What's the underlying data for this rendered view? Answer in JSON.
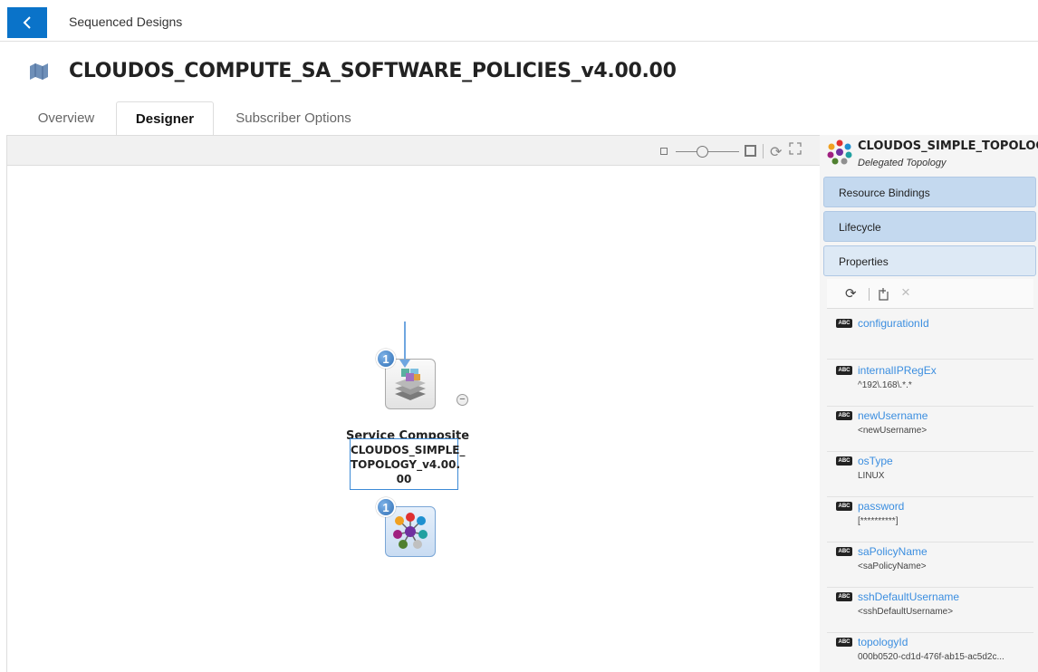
{
  "breadcrumb": "Sequenced Designs",
  "title": "CLOUDOS_COMPUTE_SA_SOFTWARE_POLICIES_v4.00.00",
  "tabs": [
    "Overview",
    "Designer",
    "Subscriber Options"
  ],
  "active_tab": "Designer",
  "canvas": {
    "node1": {
      "badge": "1",
      "label": "Service Composite",
      "collapse": "−"
    },
    "node2": {
      "badge": "1",
      "label_lines": [
        "CLOUDOS_SIMPLE_",
        "TOPOLOGY_v4.00.",
        "00"
      ]
    }
  },
  "panel": {
    "title": "CLOUDOS_SIMPLE_TOPOLOGY_v...",
    "subtitle": "Delegated Topology",
    "sections": [
      "Resource Bindings",
      "Lifecycle",
      "Properties"
    ],
    "abc_label": "ABC",
    "properties": [
      {
        "name": "configurationId",
        "value": ""
      },
      {
        "name": "internalIPRegEx",
        "value": "^192\\.168\\.*.*"
      },
      {
        "name": "newUsername",
        "value": "<newUsername>"
      },
      {
        "name": "osType",
        "value": "LINUX"
      },
      {
        "name": "password",
        "value": "[**********]"
      },
      {
        "name": "saPolicyName",
        "value": "<saPolicyName>"
      },
      {
        "name": "sshDefaultUsername",
        "value": "<sshDefaultUsername>"
      },
      {
        "name": "topologyId",
        "value": "000b0520-cd1d-476f-ab15-ac5d2c..."
      }
    ]
  },
  "colors": {
    "accent": "#0a73c9",
    "link": "#3b8ee0",
    "section": "#c4d9ef"
  },
  "icons": [
    "back-arrow-icon",
    "map-icon",
    "zoom-out-icon",
    "zoom-in-icon",
    "refresh-icon",
    "fit-screen-icon",
    "topology-icon",
    "service-composite-icon",
    "new-property-icon",
    "delete-icon",
    "string-type-icon"
  ]
}
